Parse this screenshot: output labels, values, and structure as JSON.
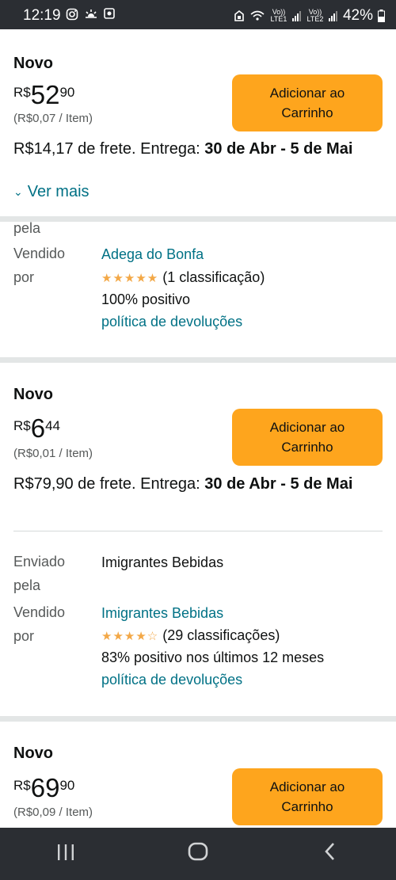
{
  "status_bar": {
    "time": "12:19",
    "left_icons": [
      "instagram-icon",
      "weather-icon",
      "app-icon"
    ],
    "volte1": "Vo)) LTE1",
    "volte2": "Vo)) LTE2",
    "battery": "42%"
  },
  "offers": [
    {
      "condition": "Novo",
      "price_currency": "R$",
      "price_whole": "52",
      "price_cents": "90",
      "unit_price": "(R$0,07 / Item)",
      "add_button": "Adicionar ao Carrinho",
      "shipping_text": "R$14,17 de frete. Entrega: ",
      "delivery_dates": "30 de Abr - 5 de Mai",
      "see_more": "Ver mais",
      "shipped_by_label_tail": "pela",
      "sold_by_label": "Vendido por",
      "seller": "Adega do Bonfa",
      "rating_stars": "★★★★★",
      "rating_text": "(1 classificação)",
      "positive": "100% positivo",
      "returns": "política de devoluções"
    },
    {
      "condition": "Novo",
      "price_currency": "R$",
      "price_whole": "6",
      "price_cents": "44",
      "unit_price": "(R$0,01 / Item)",
      "add_button": "Adicionar ao Carrinho",
      "shipping_text": "R$79,90 de frete. Entrega: ",
      "delivery_dates": "30 de Abr - 5 de Mai",
      "shipped_by_label": "Enviado pela",
      "shipped_by": "Imigrantes Bebidas",
      "sold_by_label": "Vendido por",
      "seller": "Imigrantes Bebidas",
      "rating_stars": "★★★★☆",
      "rating_text": "(29 classificações)",
      "positive": "83% positivo nos últimos 12 meses",
      "returns": "política de devoluções"
    },
    {
      "condition": "Novo",
      "price_currency": "R$",
      "price_whole": "69",
      "price_cents": "90",
      "unit_price": "(R$0,09 / Item)",
      "add_button": "Adicionar ao Carrinho"
    }
  ],
  "nav_bar": {
    "recents": "|||",
    "home": "◯",
    "back": "‹"
  }
}
